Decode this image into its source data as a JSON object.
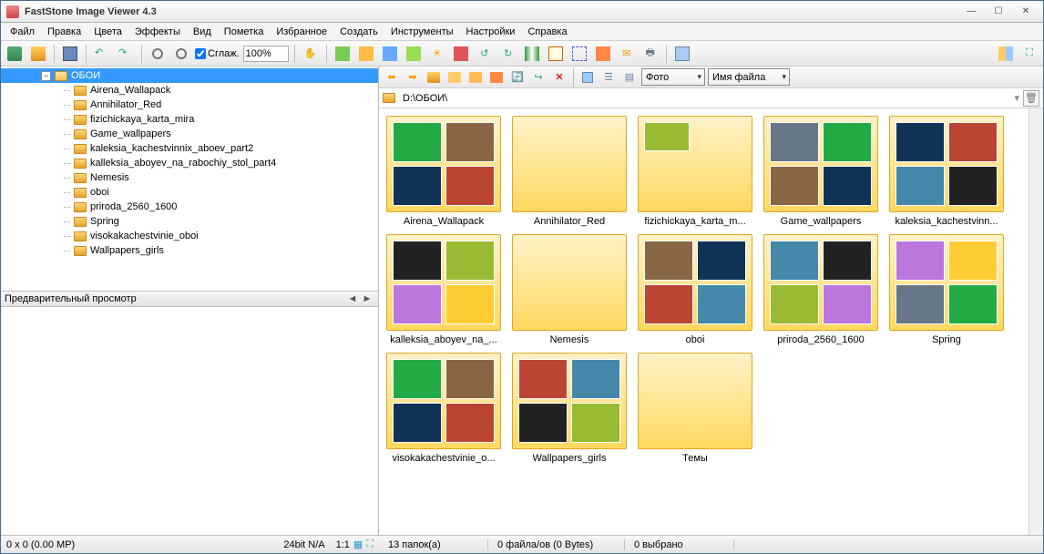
{
  "window": {
    "title": "FastStone Image Viewer 4.3"
  },
  "menu": [
    "Файл",
    "Правка",
    "Цвета",
    "Эффекты",
    "Вид",
    "Пометка",
    "Избранное",
    "Создать",
    "Инструменты",
    "Настройки",
    "Справка"
  ],
  "toolbar": {
    "smooth_label": "Сглаж.",
    "zoom_value": "100%"
  },
  "tree": {
    "root": "ОБОИ",
    "items": [
      "Airena_Wallapack",
      "Annihilator_Red",
      "fizichickaya_karta_mira",
      "Game_wallpapers",
      "kaleksia_kachestvinnix_aboev_part2",
      "kalleksia_aboyev_na_rabochiy_stol_part4",
      "Nemesis",
      "oboi",
      "priroda_2560_1600",
      "Spring",
      "visokakachestvinie_oboi",
      "Wallpapers_girls"
    ]
  },
  "preview_label": "Предварительный просмотр",
  "nav": {
    "filter_label": "Фото",
    "sort_label": "Имя файла"
  },
  "address": "D:\\ОБОИ\\",
  "thumbs": [
    {
      "label": "Airena_Wallapack",
      "tiles": 4
    },
    {
      "label": "Annihilator_Red",
      "tiles": 0
    },
    {
      "label": "fizichickaya_karta_m...",
      "tiles": 1
    },
    {
      "label": "Game_wallpapers",
      "tiles": 4
    },
    {
      "label": "kaleksia_kachestvinn...",
      "tiles": 4
    },
    {
      "label": "kalleksia_aboyev_na_...",
      "tiles": 4
    },
    {
      "label": "Nemesis",
      "tiles": 0
    },
    {
      "label": "oboi",
      "tiles": 4
    },
    {
      "label": "priroda_2560_1600",
      "tiles": 4
    },
    {
      "label": "Spring",
      "tiles": 4
    },
    {
      "label": "visokakachestvinie_o...",
      "tiles": 4
    },
    {
      "label": "Wallpapers_girls",
      "tiles": 4
    },
    {
      "label": "Темы",
      "tiles": 0
    }
  ],
  "status": {
    "dims": "0 x 0 (0.00 MP)",
    "depth": "24bit N/A",
    "ratio": "1:1",
    "folders": "13 папок(а)",
    "files": "0 файла/ов (0 Bytes)",
    "selected": "0 выбрано"
  }
}
